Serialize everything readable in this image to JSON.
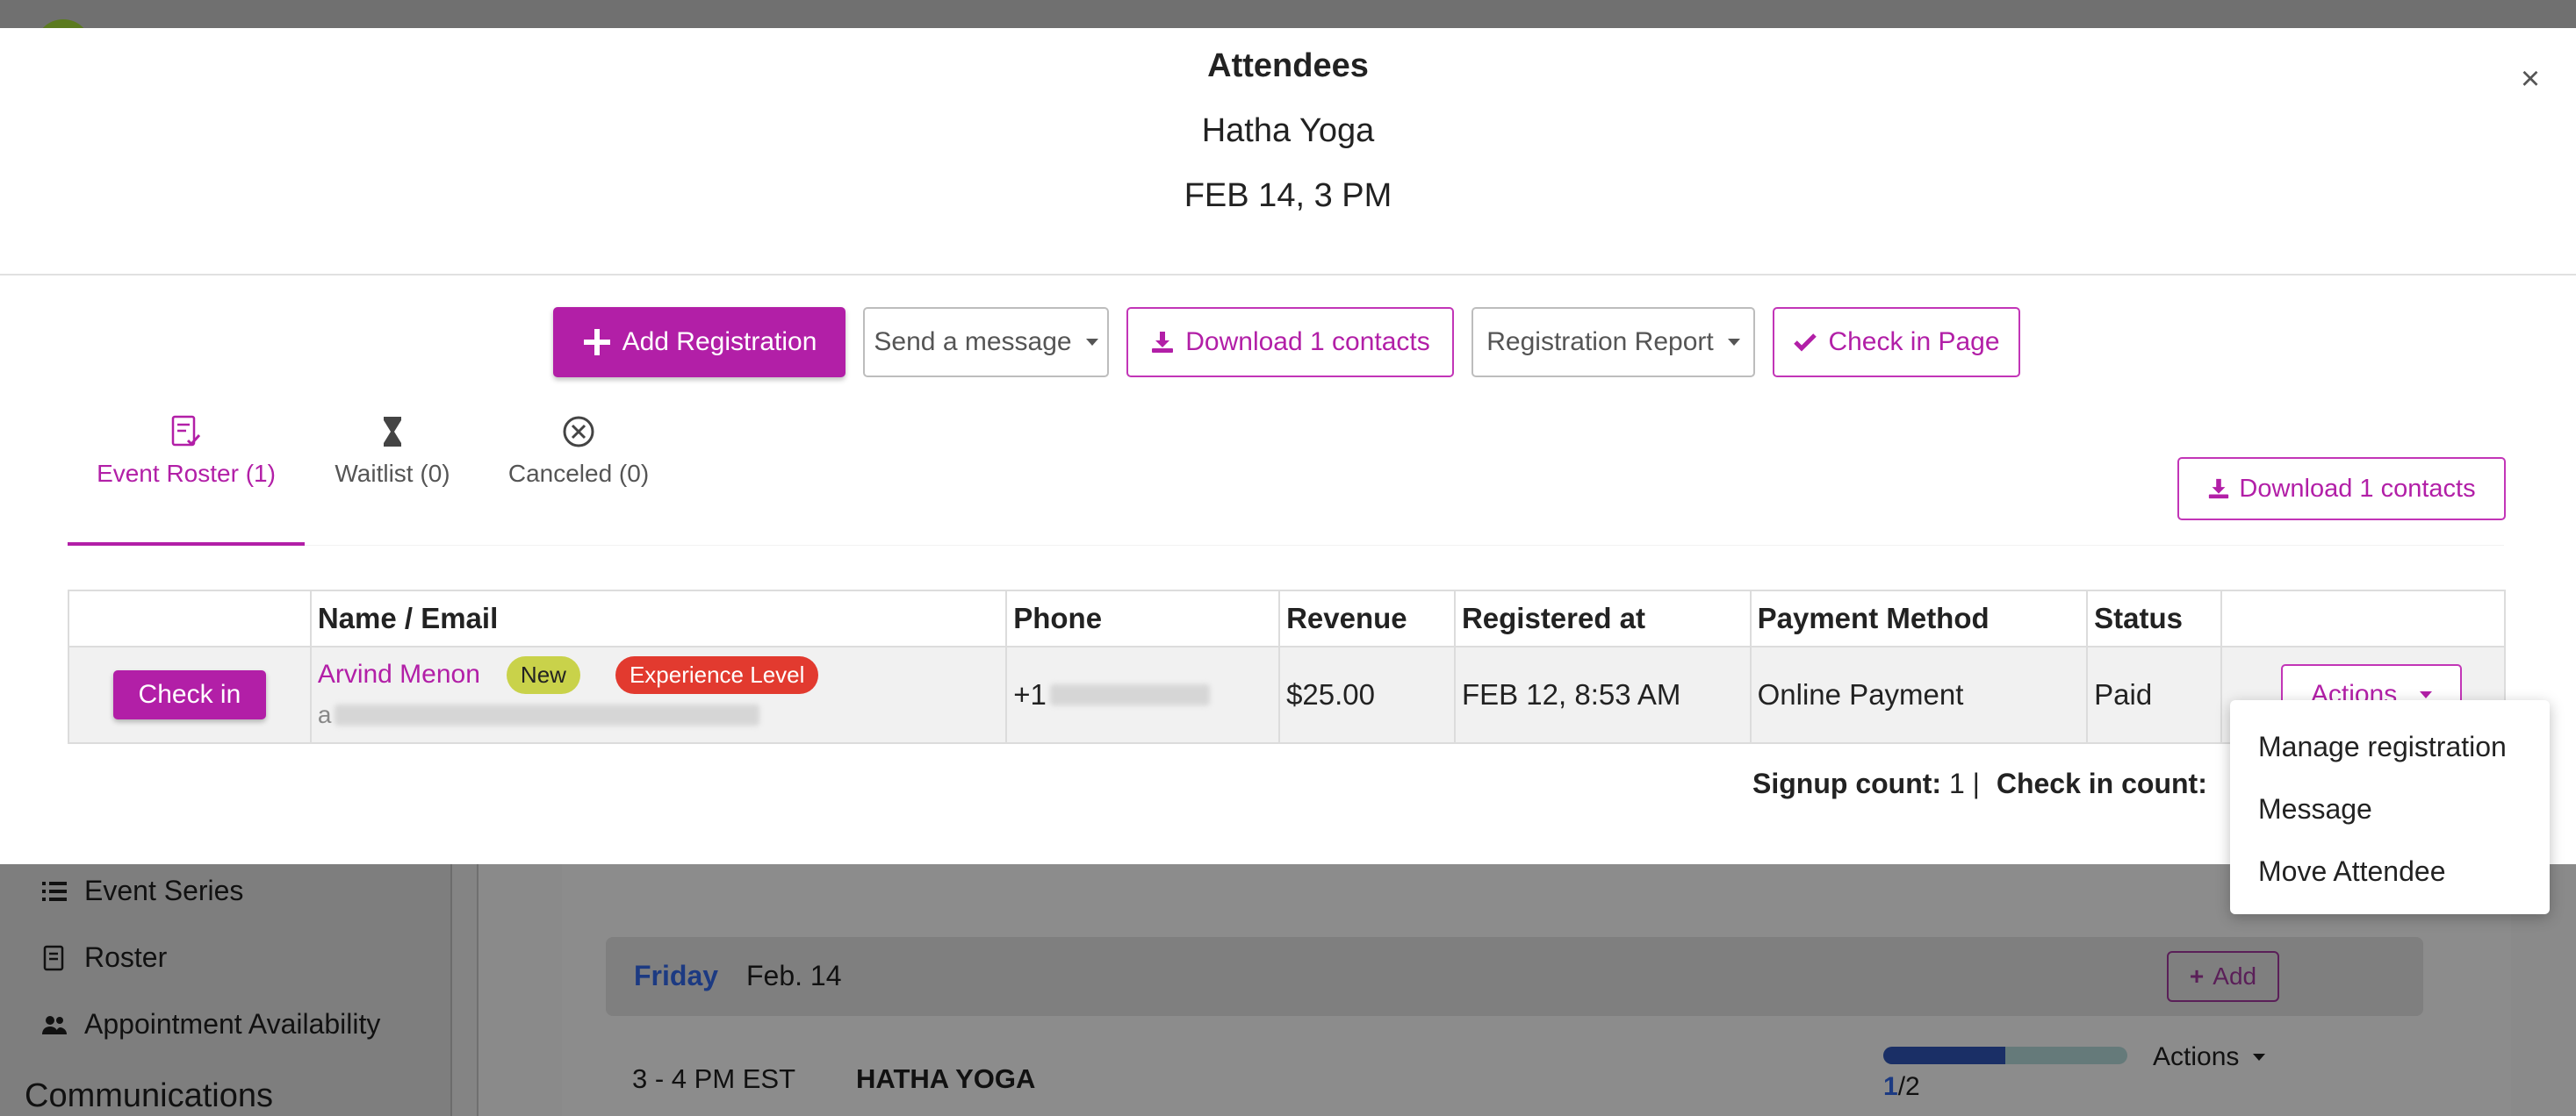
{
  "modal": {
    "title": "Attendees",
    "event_name": "Hatha Yoga",
    "event_date": "FEB 14, 3 PM",
    "close_label": "×"
  },
  "toolbar": {
    "add_registration": "Add Registration",
    "send_message": "Send a message",
    "download_contacts": "Download 1 contacts",
    "registration_report": "Registration Report",
    "check_in_page": "Check in Page"
  },
  "tabs": [
    {
      "label": "Event Roster (1)",
      "icon": "roster-check-icon",
      "active": true
    },
    {
      "label": "Waitlist (0)",
      "icon": "hourglass-icon",
      "active": false
    },
    {
      "label": "Canceled (0)",
      "icon": "circle-x-icon",
      "active": false
    }
  ],
  "download_right": "Download 1 contacts",
  "table": {
    "headers": [
      "",
      "Name / Email",
      "Phone",
      "Revenue",
      "Registered at",
      "Payment Method",
      "Status",
      ""
    ],
    "rows": [
      {
        "checkin_label": "Check in",
        "name": "Arvind Menon",
        "badge_new": "New",
        "badge_experience": "Experience Level",
        "email_prefix": "a",
        "phone_prefix": "+1",
        "revenue": "$25.00",
        "registered_at": "FEB 12, 8:53 AM",
        "payment_method": "Online Payment",
        "status": "Paid",
        "actions_label": "Actions"
      }
    ]
  },
  "counts": {
    "signup_label": "Signup count:",
    "signup_value": "1",
    "separator": "|",
    "checkin_label": "Check in count:"
  },
  "actions_menu": [
    "Manage registration",
    "Message",
    "Move Attendee"
  ],
  "background": {
    "sidebar": [
      {
        "label": "Event Series",
        "icon": "list-icon"
      },
      {
        "label": "Roster",
        "icon": "roster-icon"
      },
      {
        "label": "Appointment Availability",
        "icon": "users-icon"
      }
    ],
    "section_title": "Communications",
    "day_name": "Friday",
    "day_date": "Feb. 14",
    "add_label": "Add",
    "class_time": "3 - 4 PM EST",
    "class_title": "HATHA YOGA",
    "capacity_filled": "1",
    "capacity_total": "/2",
    "capacity_fraction": 0.5,
    "actions_label": "Actions"
  },
  "colors": {
    "brand": "#b21fa7",
    "success": "#2e8b1c",
    "badge_new": "#c9d24a",
    "badge_experience": "#e23a2f"
  }
}
